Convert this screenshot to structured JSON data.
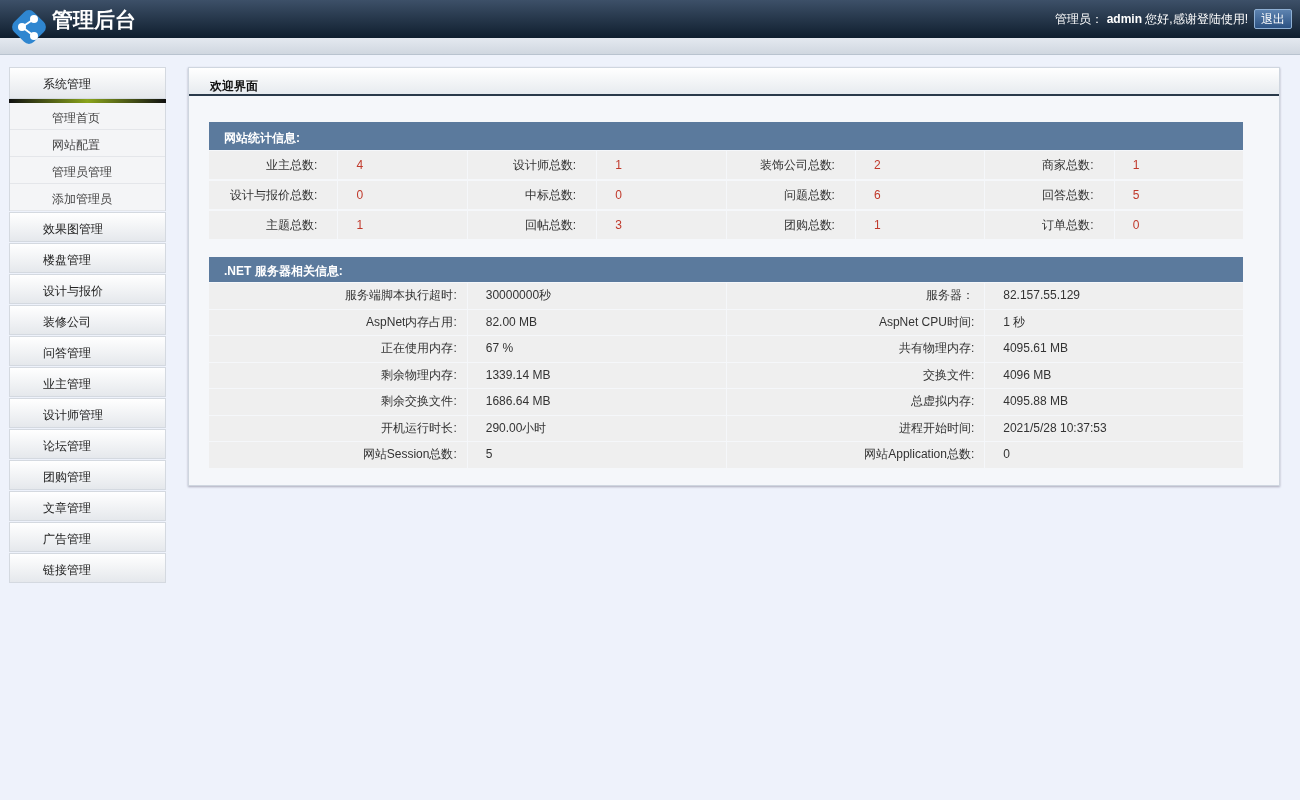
{
  "header": {
    "title": "管理后台",
    "greeting": "管理员： **admin** 您好,感谢登陆使用!",
    "logout": "退出"
  },
  "sidebar": {
    "groups": [
      {
        "label": "系统管理",
        "expanded": true,
        "children": [
          {
            "label": "管理首页"
          },
          {
            "label": "网站配置"
          },
          {
            "label": "管理员管理"
          },
          {
            "label": "添加管理员"
          }
        ]
      },
      {
        "label": "效果图管理",
        "expanded": false
      },
      {
        "label": "楼盘管理",
        "expanded": false
      },
      {
        "label": "设计与报价",
        "expanded": false
      },
      {
        "label": "装修公司",
        "expanded": false
      },
      {
        "label": "问答管理",
        "expanded": false
      },
      {
        "label": "业主管理",
        "expanded": false
      },
      {
        "label": "设计师管理",
        "expanded": false
      },
      {
        "label": "论坛管理",
        "expanded": false
      },
      {
        "label": "团购管理",
        "expanded": false
      },
      {
        "label": "文章管理",
        "expanded": false
      },
      {
        "label": "广告管理",
        "expanded": false
      },
      {
        "label": "链接管理",
        "expanded": false
      }
    ]
  },
  "panel": {
    "title": "欢迎界面",
    "sections": [
      {
        "kind": "stats",
        "title": "网站统计信息:",
        "rows": [
          [
            {
              "label": "业主总数:",
              "value": "4"
            },
            {
              "label": "设计师总数:",
              "value": "1"
            },
            {
              "label": "装饰公司总数:",
              "value": "2"
            },
            {
              "label": "商家总数:",
              "value": "1"
            }
          ],
          [
            {
              "label": "设计与报价总数:",
              "value": "0"
            },
            {
              "label": "中标总数:",
              "value": "0"
            },
            {
              "label": "问题总数:",
              "value": "6"
            },
            {
              "label": "回答总数:",
              "value": "5"
            }
          ],
          [
            {
              "label": "主题总数:",
              "value": "1"
            },
            {
              "label": "回帖总数:",
              "value": "3"
            },
            {
              "label": "团购总数:",
              "value": "1"
            },
            {
              "label": "订单总数:",
              "value": "0"
            }
          ]
        ]
      },
      {
        "kind": "server",
        "title": ".NET 服务器相关信息:",
        "rows": [
          [
            {
              "label": "服务端脚本执行超时:",
              "value": "30000000秒"
            },
            {
              "label": "服务器：",
              "value": "82.157.55.129"
            }
          ],
          [
            {
              "label": "AspNet内存占用:",
              "value": "82.00 MB"
            },
            {
              "label": "AspNet CPU时间:",
              "value": "1 秒"
            }
          ],
          [
            {
              "label": "正在使用内存:",
              "value": "67 %"
            },
            {
              "label": "共有物理内存:",
              "value": "4095.61 MB"
            }
          ],
          [
            {
              "label": "剩余物理内存:",
              "value": "1339.14 MB"
            },
            {
              "label": "交换文件:",
              "value": "4096 MB"
            }
          ],
          [
            {
              "label": "剩余交换文件:",
              "value": "1686.64 MB"
            },
            {
              "label": "总虚拟内存:",
              "value": "4095.88 MB"
            }
          ],
          [
            {
              "label": "开机运行时长:",
              "value": "290.00小时"
            },
            {
              "label": "进程开始时间:",
              "value": "2021/5/28 10:37:53"
            }
          ],
          [
            {
              "label": "网站Session总数:",
              "value": "5"
            },
            {
              "label": "网站Application总数:",
              "value": "0"
            }
          ]
        ]
      }
    ]
  }
}
